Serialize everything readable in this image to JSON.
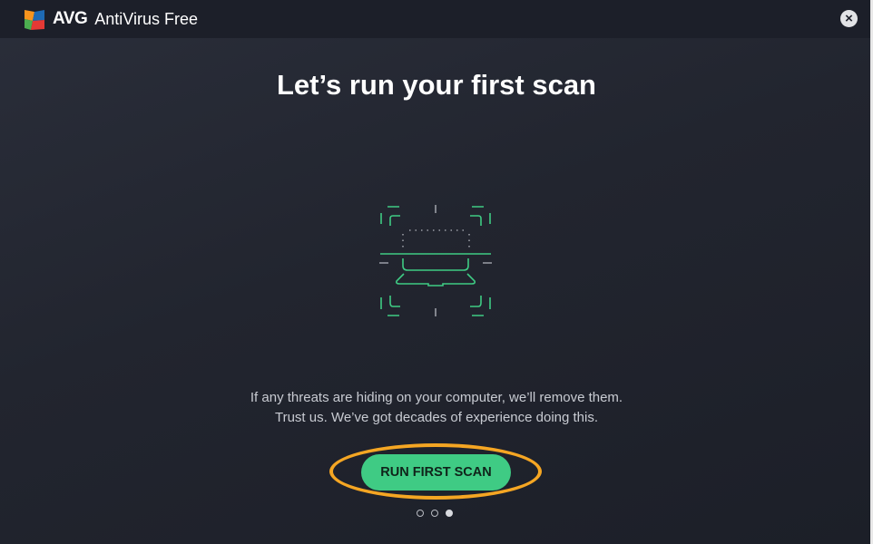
{
  "titlebar": {
    "brand": "AVG",
    "product": "AntiVirus Free",
    "close_icon": "close-icon"
  },
  "main": {
    "title": "Let’s run your first scan",
    "description_line1": "If any threats are hiding on your computer, we’ll remove them.",
    "description_line2": "Trust us. We’ve got decades of experience doing this.",
    "button_label": "RUN FIRST SCAN",
    "pagination": {
      "total": 3,
      "current": 3
    }
  },
  "colors": {
    "accent": "#3fcb84",
    "highlight": "#f5a623",
    "background": "#22252f"
  }
}
